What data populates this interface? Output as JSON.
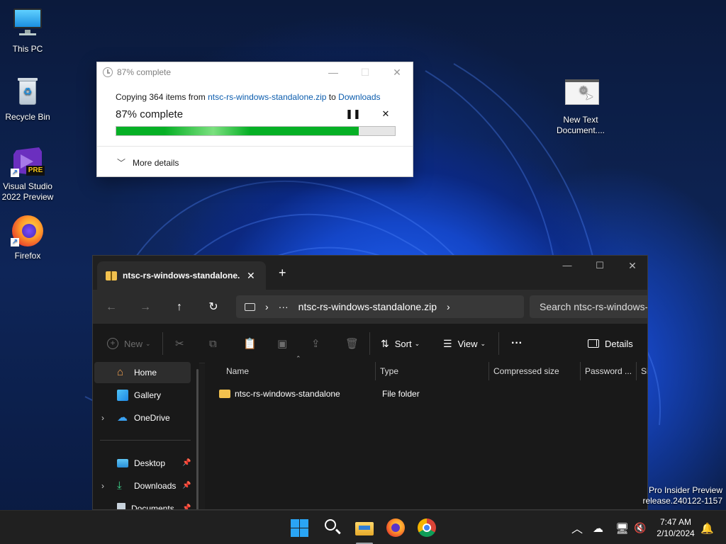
{
  "desktop": {
    "icons": [
      {
        "label": "This PC"
      },
      {
        "label": "Recycle Bin"
      },
      {
        "label_line1": "Visual Studio",
        "label_line2": "2022 Preview",
        "badge": "PRE"
      },
      {
        "label": "Firefox"
      }
    ],
    "text_file": {
      "label_line1": "New Text",
      "label_line2": "Document...."
    }
  },
  "copy_dialog": {
    "title": "87% complete",
    "copy_prefix": "Copying 364 items from ",
    "source": "ntsc-rs-windows-standalone.zip",
    "to_word": " to ",
    "destination": "Downloads",
    "percent_text": "87% complete",
    "progress": 0.87,
    "more_details": "More details",
    "accent_color": "#06b025"
  },
  "explorer": {
    "tab_title": "ntsc-rs-windows-standalone.zip",
    "address_path": "ntsc-rs-windows-standalone.zip",
    "search_placeholder": "Search ntsc-rs-windows-standalone.zip",
    "commands": {
      "new": "New",
      "sort": "Sort",
      "view": "View",
      "details": "Details"
    },
    "sidebar": [
      {
        "label": "Home"
      },
      {
        "label": "Gallery"
      },
      {
        "label": "OneDrive"
      },
      {
        "label": "Desktop"
      },
      {
        "label": "Downloads"
      },
      {
        "label": "Documents"
      }
    ],
    "columns": [
      "Name",
      "Type",
      "Compressed size",
      "Password ...",
      "Si"
    ],
    "rows": [
      {
        "name": "ntsc-rs-windows-standalone",
        "type": "File folder"
      }
    ]
  },
  "watermark": {
    "line1": "Pro Insider Preview",
    "line2": "release.240122-1157"
  },
  "taskbar": {
    "time": "7:47 AM",
    "date": "2/10/2024"
  }
}
